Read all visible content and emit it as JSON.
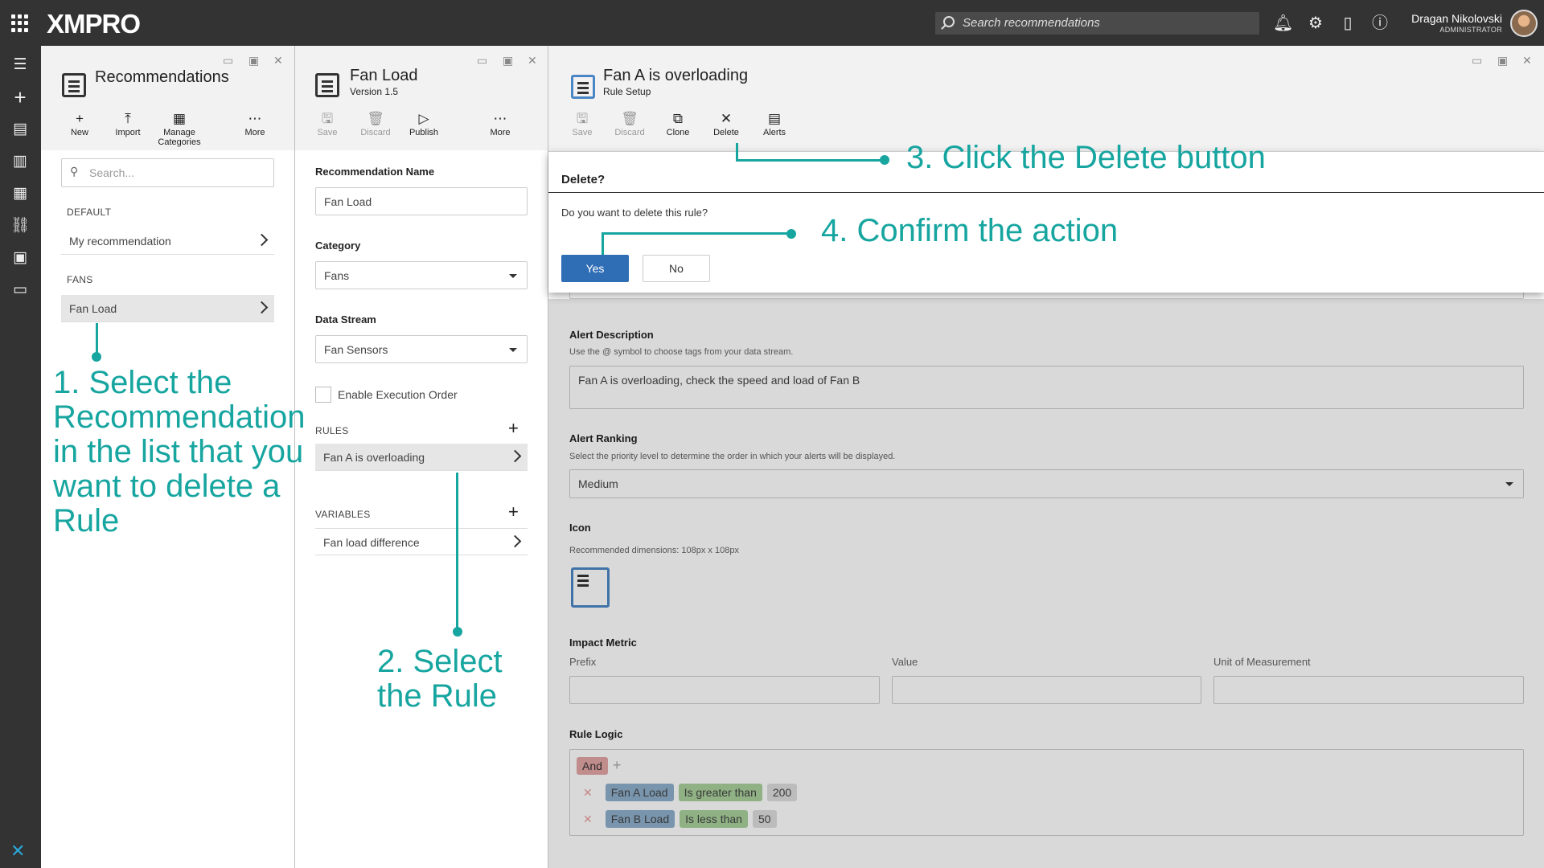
{
  "topbar": {
    "brand": "XMPRO",
    "search_placeholder": "Search recommendations",
    "user_name": "Dragan Nikolovski",
    "user_role": "ADMINISTRATOR"
  },
  "panel1": {
    "title": "Recommendations",
    "toolbar": {
      "new": "New",
      "import": "Import",
      "manage": "Manage Categories",
      "more": "More"
    },
    "search_placeholder": "Search...",
    "sections": [
      {
        "label": "DEFAULT",
        "items": [
          "My recommendation"
        ]
      },
      {
        "label": "FANS",
        "items": [
          "Fan Load"
        ]
      }
    ]
  },
  "panel2": {
    "title": "Fan Load",
    "subtitle": "Version 1.5",
    "toolbar": {
      "save": "Save",
      "discard": "Discard",
      "publish": "Publish",
      "more": "More"
    },
    "name_label": "Recommendation Name",
    "name_value": "Fan Load",
    "category_label": "Category",
    "category_value": "Fans",
    "stream_label": "Data Stream",
    "stream_value": "Fan Sensors",
    "exec_order": "Enable Execution Order",
    "rules_label": "RULES",
    "rules": [
      "Fan A is overloading"
    ],
    "variables_label": "VARIABLES",
    "variables": [
      "Fan load difference"
    ]
  },
  "panel3": {
    "title": "Fan A is overloading",
    "subtitle": "Rule Setup",
    "toolbar": {
      "save": "Save",
      "discard": "Discard",
      "clone": "Clone",
      "delete": "Delete",
      "alerts": "Alerts"
    },
    "dialog": {
      "title": "Delete?",
      "message": "Do you want to delete this rule?",
      "yes": "Yes",
      "no": "No"
    },
    "alert_desc_label": "Alert Description",
    "alert_desc_hint": "Use the @ symbol to choose tags from your data stream.",
    "alert_desc_value": "Fan A is overloading, check the speed and load of Fan B",
    "ranking_label": "Alert Ranking",
    "ranking_hint": "Select the priority level to determine the order in which your alerts will be displayed.",
    "ranking_value": "Medium",
    "icon_label": "Icon",
    "icon_hint": "Recommended dimensions: 108px x 108px",
    "impact_label": "Impact Metric",
    "impact_prefix": "Prefix",
    "impact_value": "Value",
    "impact_unit": "Unit of Measurement",
    "logic_label": "Rule Logic",
    "logic_op": "And",
    "conditions": [
      {
        "tag": "Fan A Load",
        "op": "Is greater than",
        "val": "200"
      },
      {
        "tag": "Fan B Load",
        "op": "Is less than",
        "val": "50"
      }
    ]
  },
  "annotations": {
    "step1": "1. Select the Recommendation in the list that you want to delete a Rule",
    "step2": "2. Select the Rule",
    "step3": "3. Click the Delete button",
    "step4": "4. Confirm the action"
  }
}
